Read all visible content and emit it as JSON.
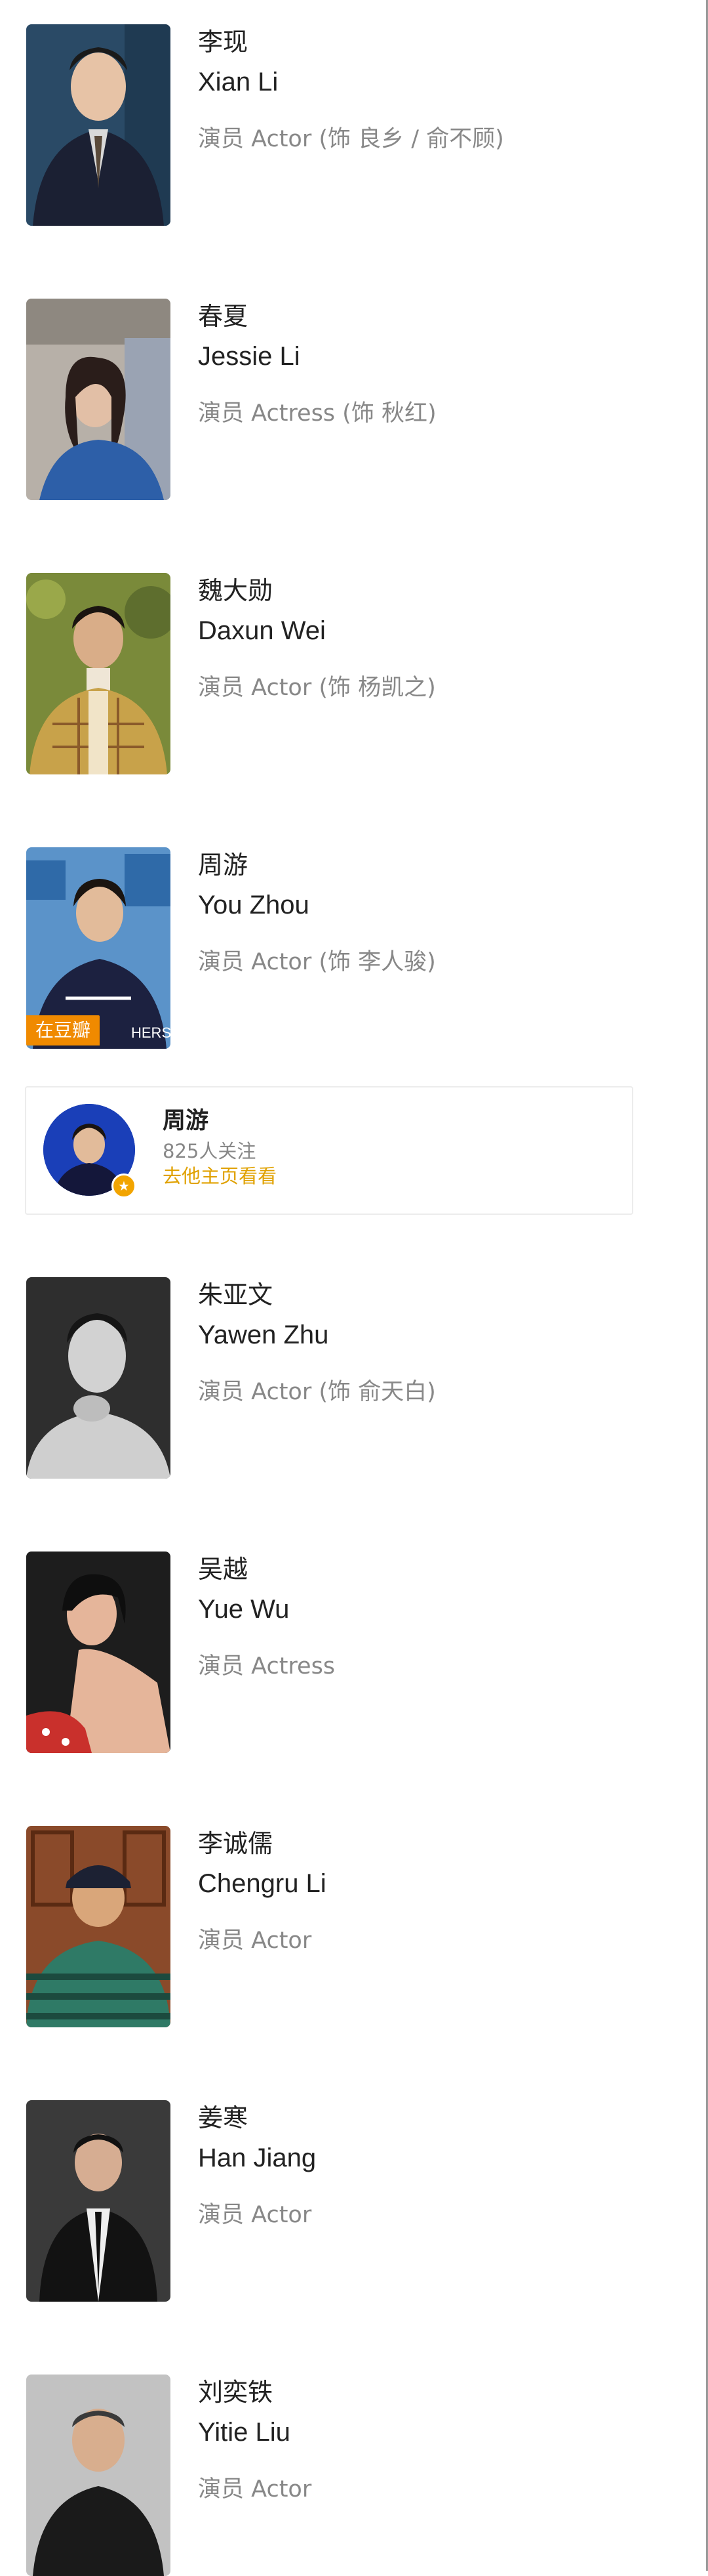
{
  "cast": [
    {
      "cn": "李现",
      "en": "Xian Li",
      "role": "演员 Actor (饰 良乡 / 俞不顾)",
      "photo_icon": "actor-photo",
      "colors": {
        "bg": "#2a4a66",
        "skin": "#e7c3a6",
        "cloth": "#1b2033"
      }
    },
    {
      "cn": "春夏",
      "en": "Jessie Li",
      "role": "演员 Actress (饰 秋红)",
      "photo_icon": "actress-photo",
      "colors": {
        "bg": "#b7b0a8",
        "skin": "#e2bfa6",
        "cloth": "#2d5fa8"
      }
    },
    {
      "cn": "魏大勋",
      "en": "Daxun Wei",
      "role": "演员 Actor (饰 杨凯之)",
      "photo_icon": "actor-photo",
      "colors": {
        "bg": "#7a8a3a",
        "skin": "#d9ad88",
        "cloth": "#c8a24a"
      }
    },
    {
      "cn": "周游",
      "en": "You Zhou",
      "role": "演员 Actor (饰 李人骏)",
      "photo_icon": "actor-photo",
      "badge": "在豆瓣",
      "colors": {
        "bg": "#5b93c9",
        "skin": "#e2bb9a",
        "cloth": "#1c2140"
      }
    },
    {
      "cn": "朱亚文",
      "en": "Yawen Zhu",
      "role": "演员 Actor (饰 俞天白)",
      "photo_icon": "actor-photo",
      "colors": {
        "bg": "#2e2e2e",
        "skin": "#d2d2d2",
        "cloth": "#cfcfcf"
      }
    },
    {
      "cn": "吴越",
      "en": "Yue Wu",
      "role": "演员 Actress",
      "photo_icon": "actress-photo",
      "colors": {
        "bg": "#1d1d1d",
        "skin": "#e5b59a",
        "cloth": "#c9302c"
      }
    },
    {
      "cn": "李诚儒",
      "en": "Chengru Li",
      "role": "演员 Actor",
      "photo_icon": "actor-photo",
      "colors": {
        "bg": "#8a4a2a",
        "skin": "#d9a67a",
        "cloth": "#2f7a66"
      }
    },
    {
      "cn": "姜寒",
      "en": "Han Jiang",
      "role": "演员 Actor",
      "photo_icon": "actor-photo",
      "colors": {
        "bg": "#3a3a3a",
        "skin": "#d6ad92",
        "cloth": "#121212"
      }
    },
    {
      "cn": "刘奕铁",
      "en": "Yitie Liu",
      "role": "演员 Actor",
      "photo_icon": "actor-photo",
      "colors": {
        "bg": "#c2c2c2",
        "skin": "#d8ae8e",
        "cloth": "#1a1a1a"
      }
    }
  ],
  "profile_card": {
    "name": "周游",
    "followers": "825人关注",
    "link": "去他主页看看",
    "avatar_icon": "avatar",
    "verified_icon": "verified-star-icon",
    "colors": {
      "avatar_bg": "#1a3fb8",
      "link": "#e0a100"
    }
  }
}
